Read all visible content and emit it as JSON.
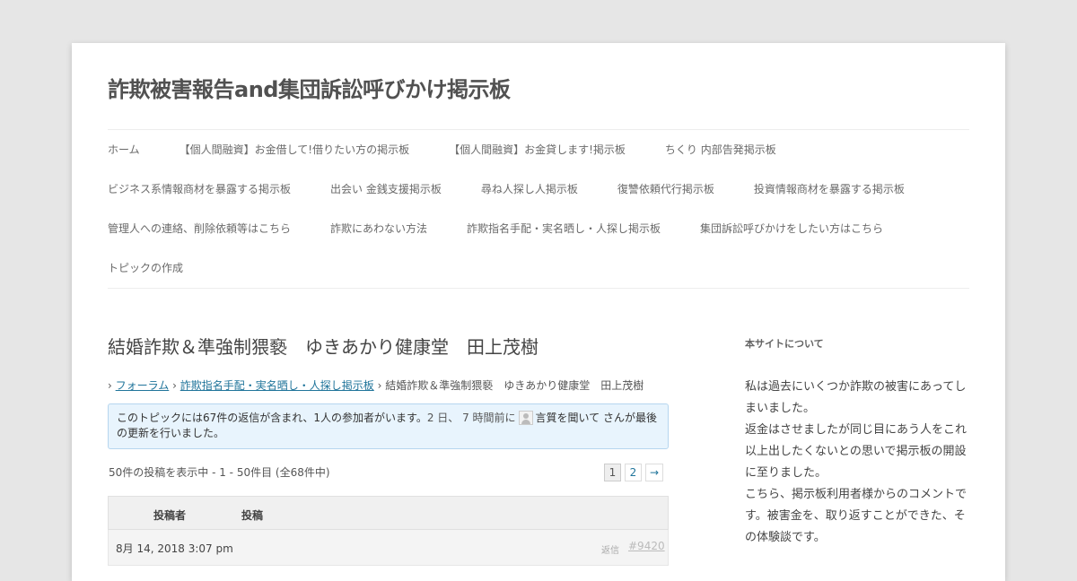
{
  "site": {
    "title": "詐欺被害報告and集団訴訟呼びかけ掲示板"
  },
  "nav": {
    "row1": [
      "ホーム",
      "【個人間融資】お金借して!借りたい方の掲示板",
      "【個人間融資】お金貸します!掲示板",
      "ちくり 内部告発掲示板"
    ],
    "row2": [
      "ビジネス系情報商材を暴露する掲示板",
      "出会い 金銭支援掲示板",
      "尋ね人探し人掲示板",
      "復讐依頼代行掲示板",
      "投資情報商材を暴露する掲示板"
    ],
    "row3": [
      "管理人への連絡、削除依頼等はこちら",
      "詐欺にあわない方法",
      "詐欺指名手配・実名晒し・人探し掲示板",
      "集団訴訟呼びかけをしたい方はこちら"
    ],
    "row4": [
      "トピックの作成"
    ]
  },
  "topic": {
    "title": "結婚詐欺＆準強制猥褻　ゆきあかり健康堂　田上茂樹",
    "breadcrumb": {
      "sep": "›",
      "forum": "フォーラム",
      "board": "詐欺指名手配・実名晒し・人探し掲示板",
      "current": "結婚詐欺＆準強制猥褻　ゆきあかり健康堂　田上茂樹"
    },
    "notice": {
      "text": "このトピックには67件の返信が含まれ、1人の参加者がいます。",
      "freshness": "2 日、 7 時間前に",
      "user": "言質を聞いて",
      "suffix": "さんが最後の更新を行いました。"
    },
    "count": "50件の投稿を表示中 - 1 - 50件目 (全68件中)",
    "pagination": [
      "1",
      "2",
      "→"
    ],
    "table": {
      "author": "投稿者",
      "posts": "投稿"
    },
    "first_post": {
      "date": "8月 14, 2018 3:07 pm",
      "reply": "返信",
      "permalink": "#9420"
    }
  },
  "sidebar": {
    "title": "本サイトについて",
    "paragraphs": [
      "私は過去にいくつか詐欺の被害にあってしまいました。",
      "返金はさせましたが同じ目にあう人をこれ以上出したくないとの思いで掲示板の開設に至りました。",
      "こちら、掲示板利用者様からのコメントです。被害金を、取り返すことができた、その体験談です。"
    ]
  }
}
